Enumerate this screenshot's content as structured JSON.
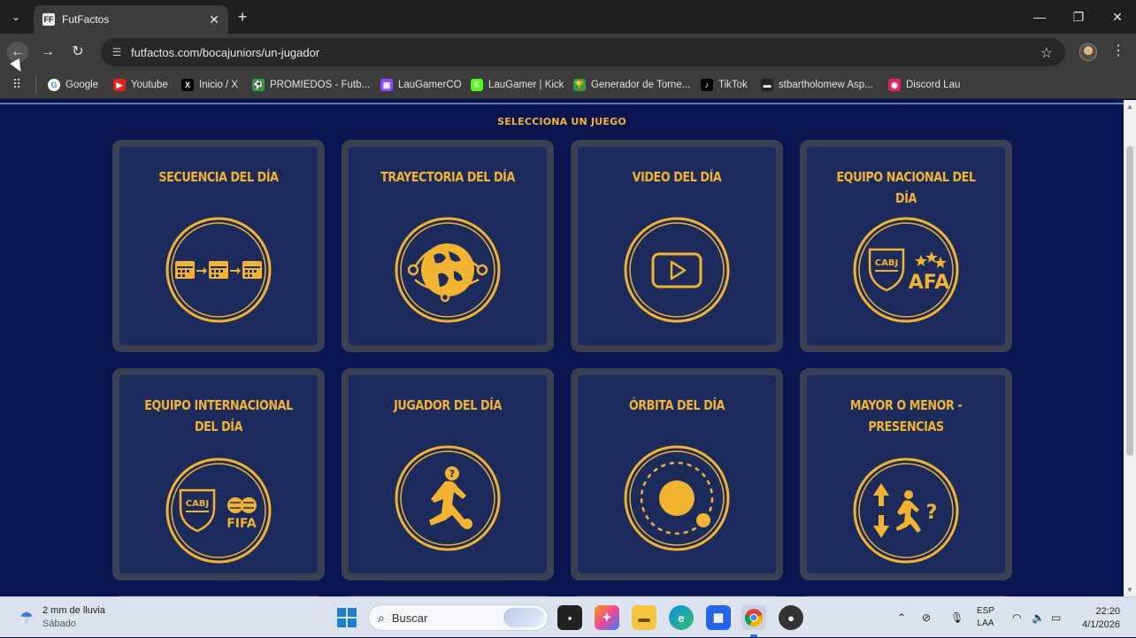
{
  "browser": {
    "tab_title": "FutFactos",
    "tab_favicon": "FF",
    "tab_close": "✕",
    "new_tab": "+",
    "url": "futfactos.com/bocajuniors/un-jugador",
    "window_controls": [
      "—",
      "❐",
      "✕"
    ]
  },
  "bookmarks": [
    {
      "label": "Google",
      "icon": "google-icon",
      "color": "#ffffff",
      "glyph": "G"
    },
    {
      "label": "Youtube",
      "icon": "youtube-icon",
      "color": "#e62117",
      "glyph": "▶"
    },
    {
      "label": "Inicio / X",
      "icon": "x-icon",
      "color": "#000000",
      "glyph": "X"
    },
    {
      "label": "PROMIEDOS - Futb...",
      "icon": "promiedos-icon",
      "color": "#2e9e3e",
      "glyph": "⚽"
    },
    {
      "label": "LauGamerCO",
      "icon": "twitch-icon",
      "color": "#9146ff",
      "glyph": "▣"
    },
    {
      "label": "LauGamer | Kick",
      "icon": "kick-icon",
      "color": "#53fc18",
      "glyph": "K"
    },
    {
      "label": "Generador de Torne...",
      "icon": "trophy-icon",
      "color": "#2e9e3e",
      "glyph": "🏆"
    },
    {
      "label": "TikTok",
      "icon": "tiktok-icon",
      "color": "#000000",
      "glyph": "♪"
    },
    {
      "label": "stbartholomew Asp...",
      "icon": "bookmark-icon",
      "color": "#222222",
      "glyph": "▬"
    },
    {
      "label": "Discord Lau",
      "icon": "discord-icon",
      "color": "#e0245e",
      "glyph": "◉"
    }
  ],
  "page": {
    "section_title": "SELECCIONA UN JUEGO",
    "accent": "#f2b430",
    "background": "#0a1550",
    "cards": [
      {
        "title": "SECUENCIA DEL DÍA",
        "icon": "calendar-sequence-icon"
      },
      {
        "title": "TRAYECTORIA DEL DÍA",
        "icon": "world-trajectory-icon"
      },
      {
        "title": "VIDEO DEL DÍA",
        "icon": "video-play-icon"
      },
      {
        "title": "EQUIPO NACIONAL DEL DÍA",
        "icon": "cabj-afa-icon"
      },
      {
        "title": "EQUIPO INTERNACIONAL DEL DÍA",
        "icon": "cabj-fifa-icon"
      },
      {
        "title": "JUGADOR DEL DÍA",
        "icon": "mystery-player-icon"
      },
      {
        "title": "ÓRBITA DEL DÍA",
        "icon": "orbit-icon"
      },
      {
        "title": "MAYOR O MENOR - PRESENCIAS",
        "icon": "higher-lower-icon"
      }
    ]
  },
  "taskbar": {
    "weather_line1": "2 mm de lluvia",
    "weather_line2": "Sábado",
    "search_placeholder": "Buscar",
    "lang_line1": "ESP",
    "lang_line2": "LAA",
    "time": "22:20",
    "date": "4/1/2026"
  }
}
